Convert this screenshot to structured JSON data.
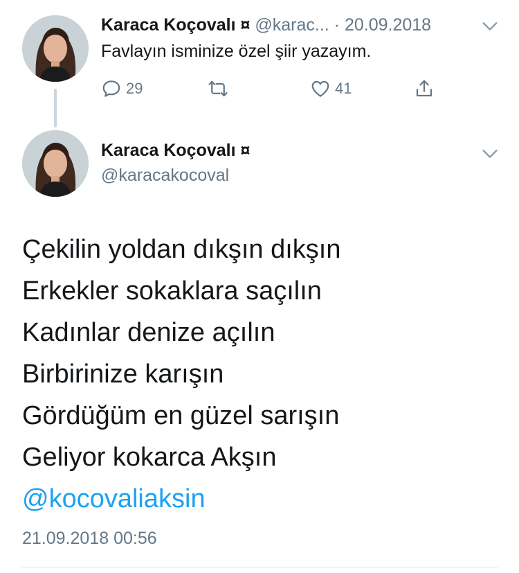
{
  "tweet1": {
    "display_name": "Karaca Koçovalı ¤",
    "handle_truncated": "@karac...",
    "separator": "·",
    "date": "20.09.2018",
    "text": "Favlayın isminize özel şiir yazayım.",
    "actions": {
      "reply_icon": "reply-icon",
      "reply_count": "29",
      "retweet_icon": "retweet-icon",
      "like_icon": "heart-icon",
      "like_count": "41",
      "share_icon": "share-icon"
    }
  },
  "tweet2": {
    "display_name": "Karaca Koçovalı ¤",
    "handle": "@karacakocoval",
    "poem_lines": [
      "Çekilin yoldan dıkşın dıkşın",
      "Erkekler sokaklara saçılın",
      "Kadınlar denize açılın",
      "Birbirinize karışın",
      "Gördüğüm en güzel sarışın",
      "Geliyor kokarca Akşın"
    ],
    "mention": "@kocovaliaksin",
    "timestamp": "21.09.2018 00:56"
  },
  "colors": {
    "text": "#14171a",
    "secondary": "#657786",
    "link": "#1da1f2",
    "thread_line": "#ccd6dd"
  }
}
